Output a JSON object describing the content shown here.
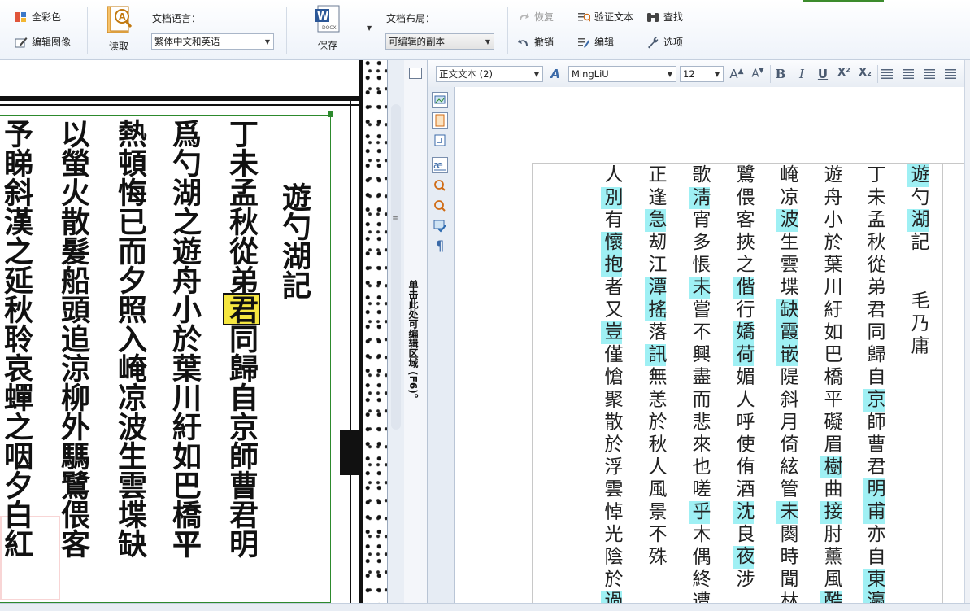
{
  "ribbon": {
    "full_color_label": "全彩色",
    "edit_image_label": "编辑图像",
    "read_label": "读取",
    "doc_language_caption": "文档语言：",
    "doc_language_value": "繁体中文和英语",
    "save_label": "保存",
    "doc_layout_caption": "文档布局：",
    "doc_layout_value": "可编辑的副本",
    "redo_label": "恢复",
    "undo_label": "撤销",
    "verify_label": "验证文本",
    "edit_label": "编辑",
    "find_label": "查找",
    "options_label": "选项",
    "docx_badge": "DOCX"
  },
  "side_panel": {
    "hint": "单击此处可编辑区域 (F6)。"
  },
  "format_bar": {
    "style_value": "正文文本 (2)",
    "font_value": "MingLiU",
    "size_value": "12",
    "grow_font": "A",
    "shrink_font": "A",
    "bold": "B",
    "italic": "I",
    "underline": "U",
    "superscript": "X²",
    "subscript": "X₂",
    "paragraph_mark": "¶"
  },
  "scan": {
    "title": "遊勺湖記",
    "col1_pre": "丁未孟秋從弟",
    "col1_hl": "君",
    "col1_post": "同歸自京師曹君明",
    "col2": "爲勺湖之遊舟小於葉川紆如巴橋平",
    "col3": "熱頓悔已而夕照入崦凉波生雲堞缺",
    "col4": "以螢火散髮船頭追涼柳外騳鷺偎客",
    "col5": "予睇斜漢之延秋聆哀蟬之咽夕白紅"
  },
  "editor": {
    "title": "遊勺湖記",
    "author": "毛乃庸",
    "col1": "丁未孟秋從弟君同歸自京師曹君明甫亦自東瀛",
    "col2": "遊舟小於葉川紆如巴橋平礙眉樹曲接肘薰風酷",
    "col3": "崦凉波生雲堞缺霞嵌隄斜月倚絃管未闋時聞林",
    "col4": "鷺偎客挾之偕行嬌荷媚人呼使侑酒沈良夜涉",
    "col5": "歌淸宵多悵未嘗不興盡而悲來也嗟乎木偶終遭",
    "col6": "正逢急刼江潭搖落訊無恙於秋人風景不殊",
    "col7": "人別有懷抱者又豈僅愴聚散於浮雲悼光陰於過"
  }
}
